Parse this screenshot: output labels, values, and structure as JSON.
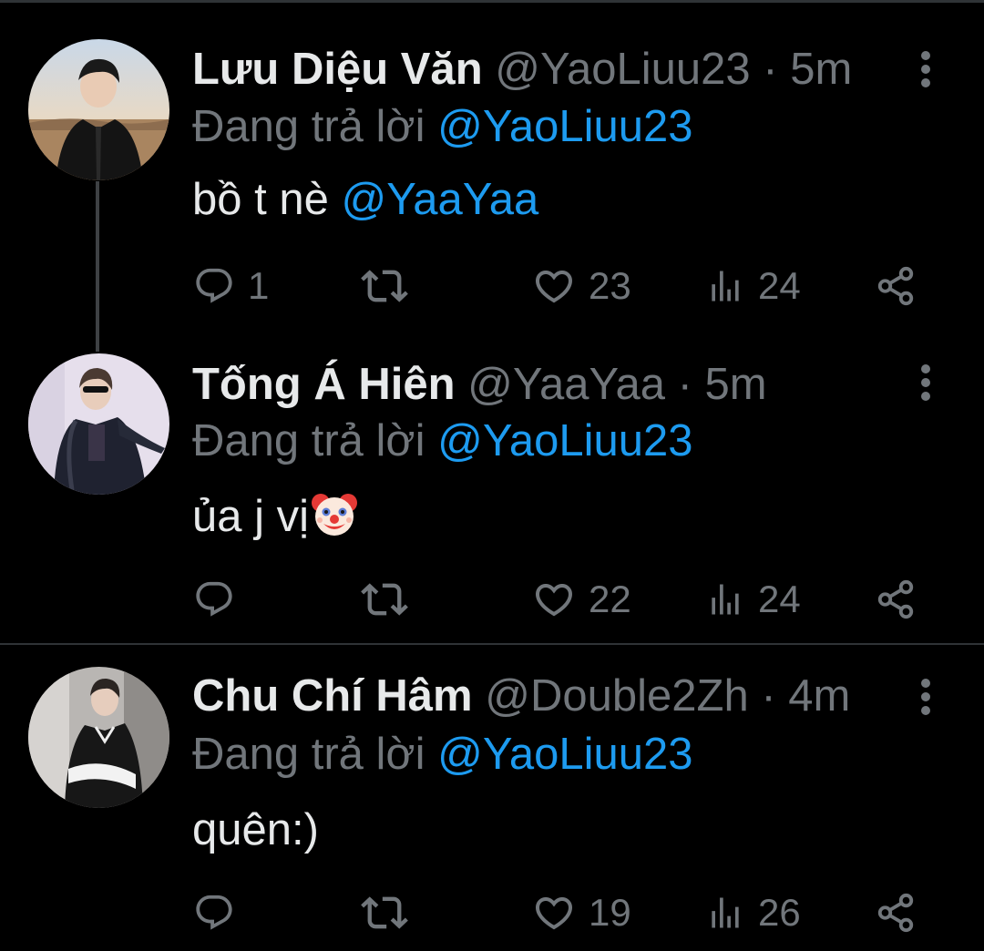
{
  "colors": {
    "background": "#000000",
    "name": "#e7e9ea",
    "muted": "#71767b",
    "mention": "#1d9bf0",
    "divider": "#2f3336"
  },
  "icons": {
    "reply": "reply-icon",
    "retweet": "retweet-icon",
    "like": "heart-icon",
    "views": "views-icon",
    "share": "share-icon",
    "more": "more-vertical-icon"
  },
  "tweets": [
    {
      "name": "Lưu Diệu Văn",
      "handle": "@YaoLiuu23",
      "separator": " · ",
      "time": "5m",
      "replying_label": "Đang trả lời ",
      "replying_to": "@YaoLiuu23",
      "text": "bồ t nè ",
      "text_mention": "@YaaYaa",
      "replies": "1",
      "retweets": "",
      "likes": "23",
      "views": "24"
    },
    {
      "name": "Tống Á Hiên",
      "handle": "@YaaYaa",
      "separator": " · ",
      "time": "5m",
      "replying_label": "Đang trả lời ",
      "replying_to": "@YaoLiuu23",
      "text": "ủa j vị",
      "emoji": "clown-face",
      "replies": "",
      "retweets": "",
      "likes": "22",
      "views": "24"
    },
    {
      "name": "Chu Chí Hâm",
      "handle": "@Double2Zh",
      "separator": " · ",
      "time": "4m",
      "replying_label": "Đang trả lời ",
      "replying_to": "@YaoLiuu23",
      "text": "quên:)",
      "replies": "",
      "retweets": "",
      "likes": "19",
      "views": "26"
    }
  ]
}
